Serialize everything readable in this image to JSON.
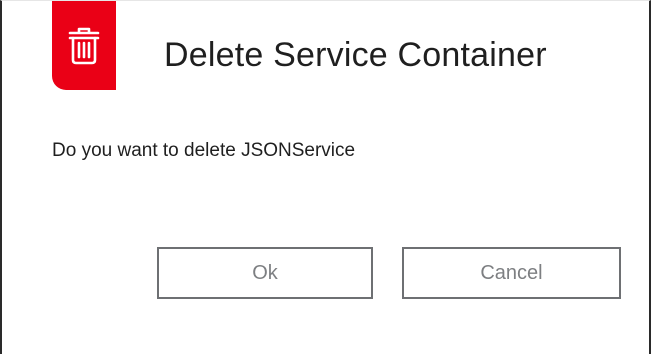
{
  "dialog": {
    "icon": "trash-icon",
    "accent_color": "#ea0016",
    "title": "Delete Service Container",
    "message": "Do you want to delete JSONService",
    "buttons": {
      "ok_label": "Ok",
      "cancel_label": "Cancel"
    }
  }
}
